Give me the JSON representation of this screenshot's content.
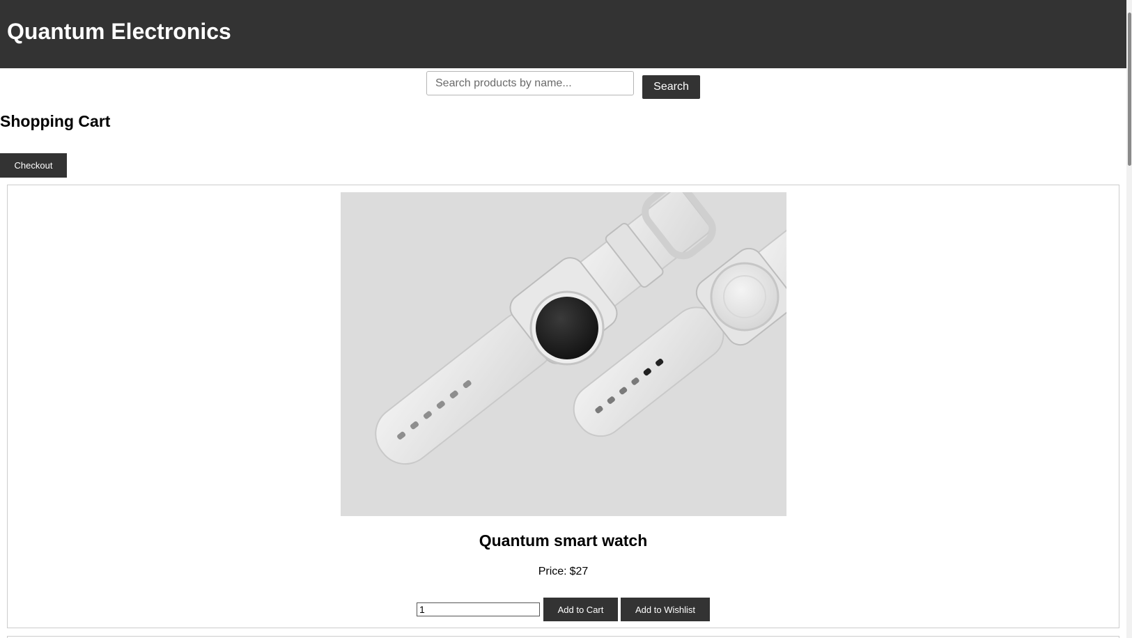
{
  "header": {
    "title": "Quantum Electronics"
  },
  "search": {
    "placeholder": "Search products by name...",
    "value": "",
    "button_label": "Search"
  },
  "cart": {
    "title": "Shopping Cart",
    "checkout_label": "Checkout"
  },
  "product": {
    "image_icon": "smart-watch-image",
    "name": "Quantum smart watch",
    "price_label": "Price:",
    "price_value": "$27",
    "quantity": "1",
    "add_to_cart_label": "Add to Cart",
    "add_to_wishlist_label": "Add to Wishlist"
  },
  "colors": {
    "header_bg": "#333333",
    "button_bg": "#333333",
    "button_text": "#ffffff",
    "image_bg": "#dcdcdc"
  }
}
